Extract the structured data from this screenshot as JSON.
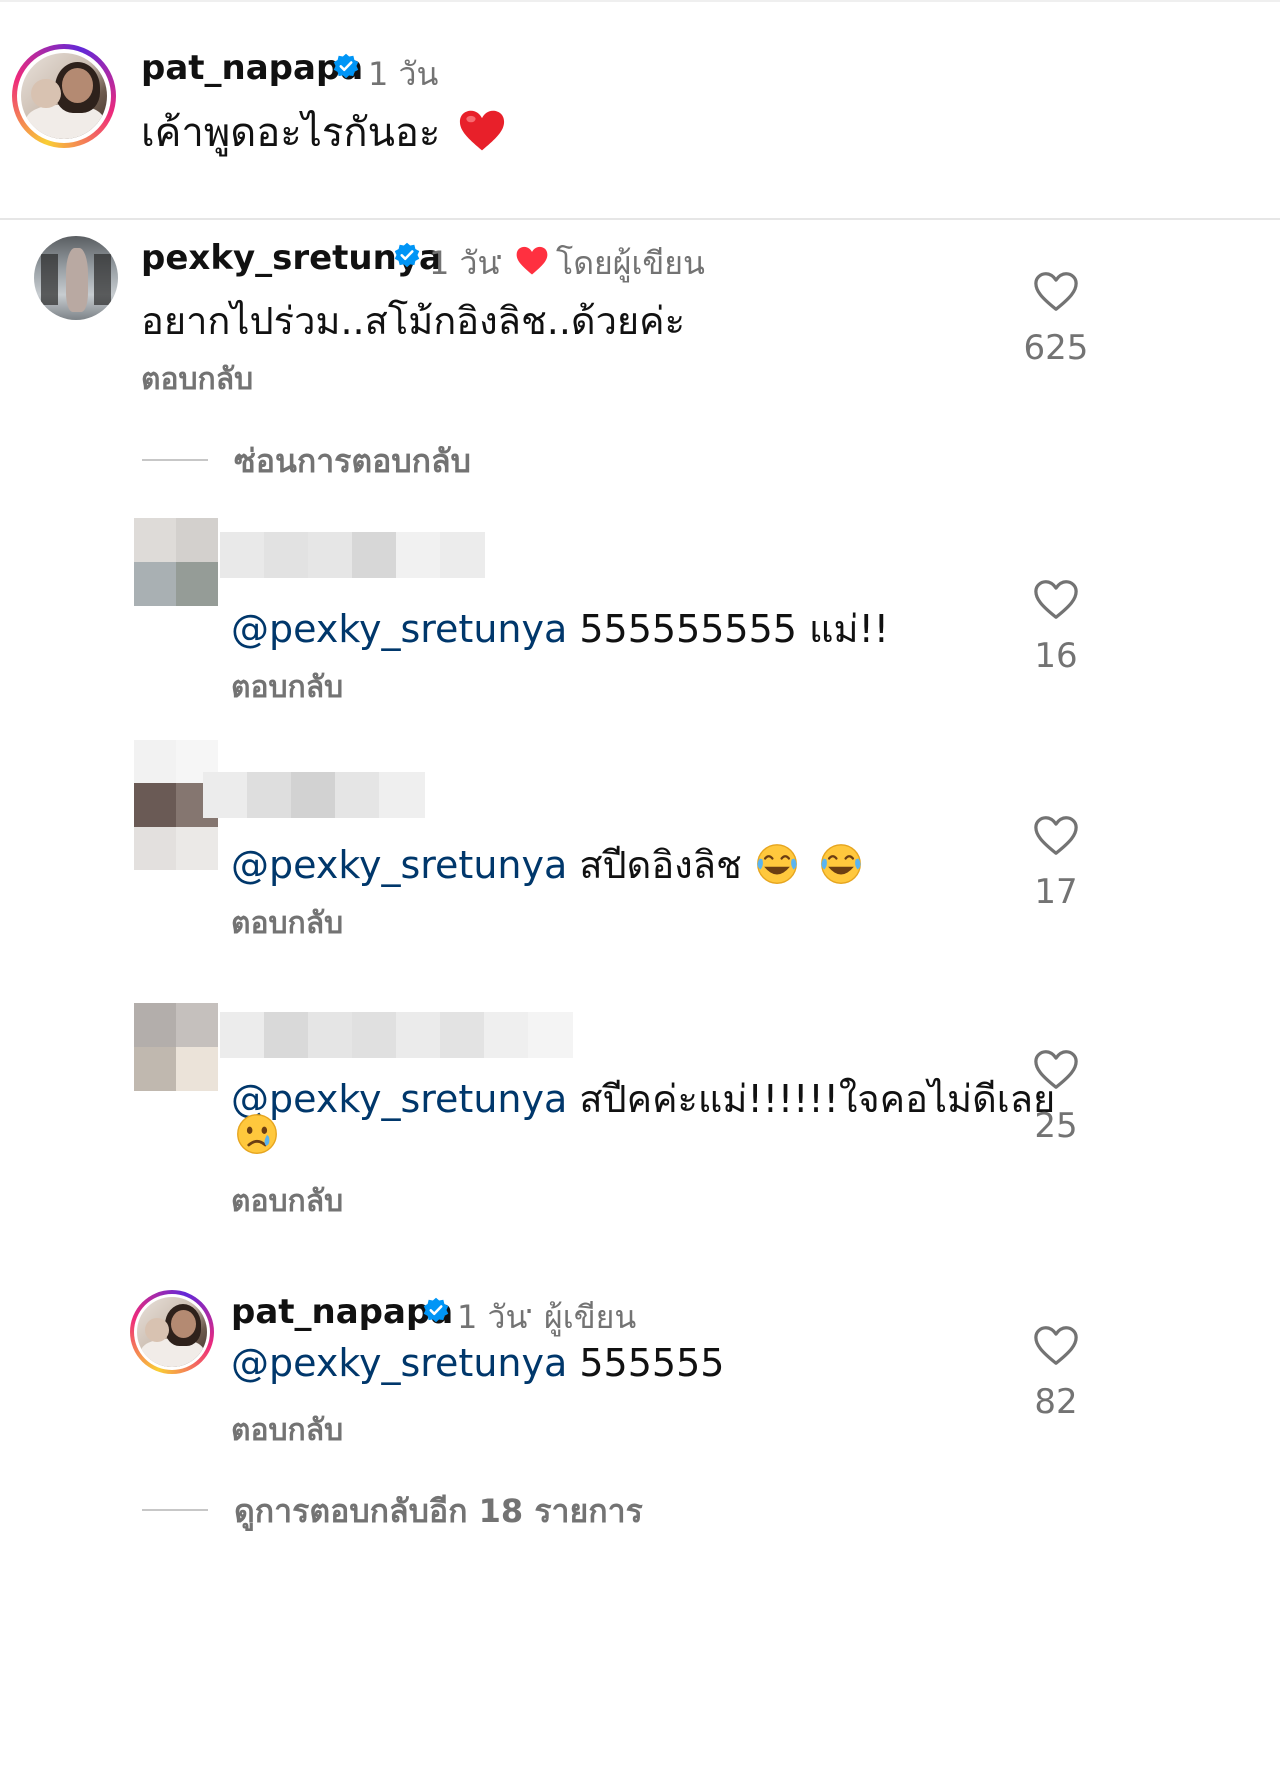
{
  "caption": {
    "username": "pat_napapa",
    "time": "1 วัน",
    "text": "เค้าพูดอะไรกันอะ"
  },
  "comment": {
    "username": "pexky_sretunya",
    "time": "1 วัน",
    "separator": "·",
    "by_author": "โดยผู้เขียน",
    "text": "อยากไปร่วม..สโม้กอิงลิช..ด้วยค่ะ",
    "reply_label": "ตอบกลับ",
    "likes": "625",
    "hide_replies": "ซ่อนการตอบกลับ"
  },
  "replies": [
    {
      "mention": "@pexky_sretunya",
      "text": " 555555555 แม่!!",
      "reply_label": "ตอบกลับ",
      "likes": "16"
    },
    {
      "mention": "@pexky_sretunya",
      "text": " สปีดอิงลิช",
      "reply_label": "ตอบกลับ",
      "likes": "17"
    },
    {
      "mention": "@pexky_sretunya",
      "text": " สปีคค่ะแม่!!!!!!ใจคอไม่ดีเลย",
      "reply_label": "ตอบกลับ",
      "likes": "25"
    }
  ],
  "author_reply": {
    "username": "pat_napapa",
    "time": "1 วัน",
    "separator": "·",
    "role": "ผู้เขียน",
    "mention": "@pexky_sretunya",
    "text": " 555555",
    "reply_label": "ตอบกลับ",
    "likes": "82"
  },
  "view_more_replies": "ดูการตอบกลับอีก 18 รายการ",
  "icons": {
    "verified": "verified-badge-icon",
    "like": "heart-outline-icon",
    "liked_by_author": "red-heart-icon",
    "laugh": "face-with-tears-of-joy-icon",
    "cry": "crying-face-icon"
  },
  "colors": {
    "mention": "#00376b",
    "muted": "#737373",
    "verified": "#0095f6",
    "heart": "#ff3040"
  }
}
